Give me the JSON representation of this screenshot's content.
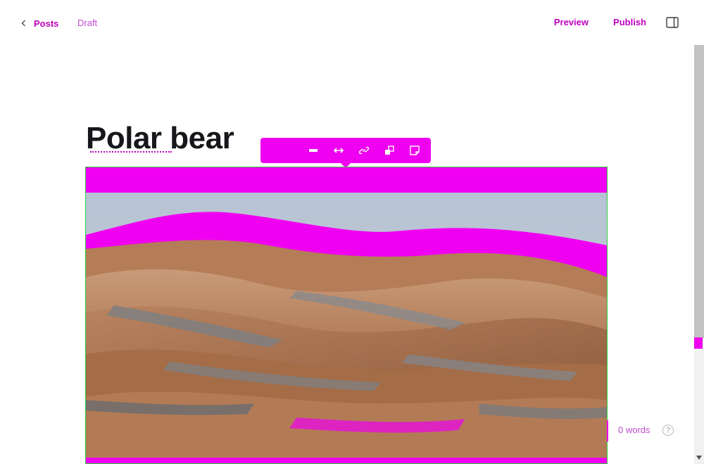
{
  "header": {
    "back_label": "Posts",
    "status": "Draft",
    "preview_label": "Preview",
    "publish_label": "Publish"
  },
  "editor": {
    "title": "Polar bear"
  },
  "image_toolbar": {
    "buttons": [
      "minus-icon",
      "arrows-horizontal-icon",
      "link-icon",
      "replace-image-icon",
      "snippet-icon"
    ]
  },
  "footer": {
    "word_count": "0 words",
    "help_label": "?"
  },
  "colors": {
    "accent": "#f000f0",
    "text": "#15171a",
    "image_border": "#30cf43"
  }
}
